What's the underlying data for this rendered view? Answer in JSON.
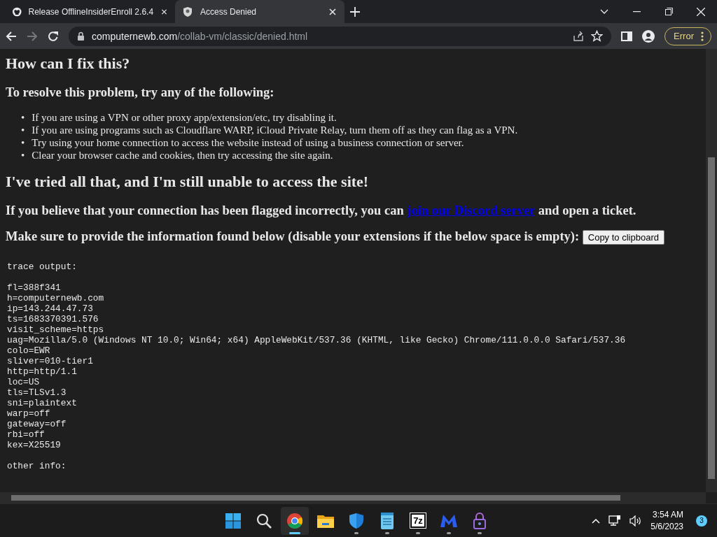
{
  "tabs": [
    {
      "title": "Release OfflineInsiderEnroll 2.6.4",
      "kind": "github",
      "selected": false
    },
    {
      "title": "Access Denied",
      "kind": "shield",
      "selected": true
    }
  ],
  "address": {
    "domain": "computernewb.com",
    "path": "/collab-vm/classic/denied.html"
  },
  "profile_button": "Error",
  "page": {
    "heading_fix": "How can I fix this?",
    "resolve_heading": "To resolve this problem, try any of the following:",
    "tips": [
      {
        "bullet": "•",
        "text": "If you are using a VPN or other proxy app/extension/etc, try disabling it."
      },
      {
        "bullet": "•",
        "text": "If you are using programs such as Cloudflare WARP, iCloud Private Relay, turn them off as they can flag as a VPN."
      },
      {
        "bullet": "•",
        "text": "Try using your home connection to access the website instead of using a business connection or server."
      },
      {
        "bullet": "•",
        "text": "Clear your browser cache and cookies, then try accessing the site again."
      }
    ],
    "heading_tried": "I've tried all that, and I'm still unable to access the site!",
    "flagged": {
      "before": "If you believe that your connection has been flagged incorrectly, you can",
      "link": "join our Discord server",
      "after": "and open a ticket."
    },
    "provide": "Make sure to provide the information found below (disable your extensions if the below space is empty):",
    "copy_button": "Copy to clipboard",
    "trace_title": "trace output:",
    "trace_lines": [
      "fl=388f341",
      "h=computernewb.com",
      "ip=143.244.47.73",
      "ts=1683370391.576",
      "visit_scheme=https",
      "uag=Mozilla/5.0 (Windows NT 10.0; Win64; x64) AppleWebKit/537.36 (KHTML, like Gecko) Chrome/111.0.0.0 Safari/537.36",
      "colo=EWR",
      "sliver=010-tier1",
      "http=http/1.1",
      "loc=US",
      "tls=TLSv1.3",
      "sni=plaintext",
      "warp=off",
      "gateway=off",
      "rbi=off",
      "kex=X25519"
    ],
    "other_info": "other info:"
  },
  "taskbar": {
    "apps": [
      {
        "kind": "start",
        "selected": false,
        "running": false
      },
      {
        "kind": "search",
        "selected": false,
        "running": false
      },
      {
        "kind": "chrome",
        "selected": true,
        "running": true
      },
      {
        "kind": "files",
        "selected": false,
        "running": false
      },
      {
        "kind": "defender",
        "selected": false,
        "running": true
      },
      {
        "kind": "notepad",
        "selected": false,
        "running": true
      },
      {
        "kind": "sevenzip",
        "label": "7z",
        "selected": false,
        "running": true
      },
      {
        "kind": "malwarebytes",
        "selected": false,
        "running": true
      },
      {
        "kind": "lock",
        "selected": false,
        "running": true
      }
    ],
    "time": "3:54 AM",
    "date": "5/6/2023",
    "notifications": "3"
  }
}
